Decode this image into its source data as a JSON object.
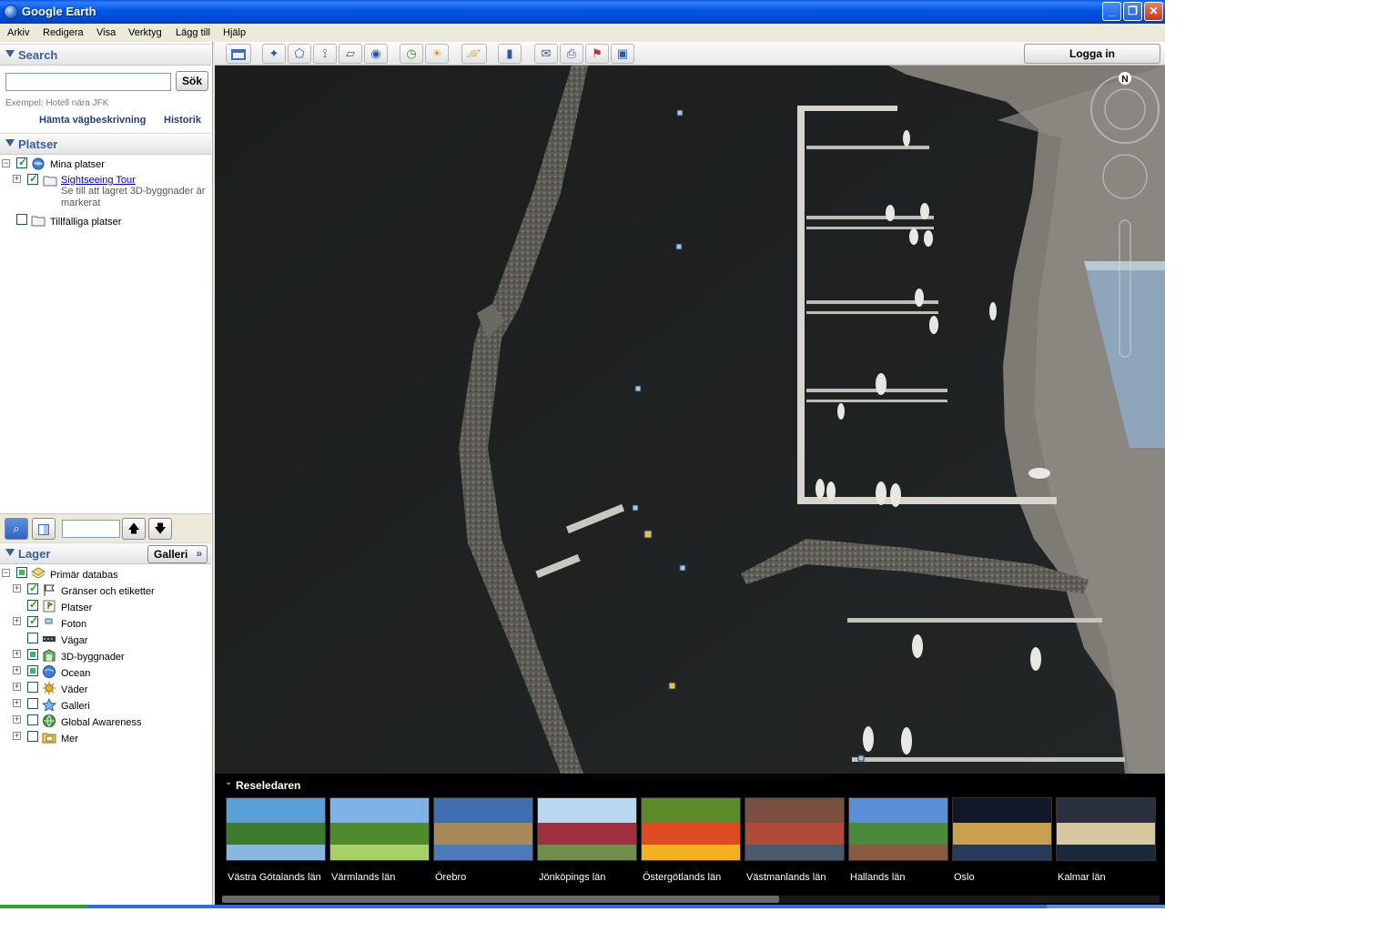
{
  "window": {
    "title": "Google Earth"
  },
  "menu": [
    "Arkiv",
    "Redigera",
    "Visa",
    "Verktyg",
    "Lägg till",
    "Hjälp"
  ],
  "search": {
    "title": "Search",
    "value": "",
    "placeholder": "",
    "button": "Sök",
    "example": "Exempel: Hotell nära JFK",
    "directions_link": "Hämta vägbeskrivning",
    "history_link": "Historik"
  },
  "places": {
    "title": "Platser",
    "my_places": "Mina platser",
    "tour_name": "Sightseeing Tour",
    "tour_desc_line1": "Se till att lagret 3D-byggnader är",
    "tour_desc_line2": "markerat",
    "temp_places": "Tillfälliga platser"
  },
  "layers": {
    "title": "Lager",
    "gallery_button": "Galleri",
    "primary_db": "Primär databas",
    "items": [
      {
        "label": "Gränser och etiketter",
        "checked": true,
        "expandable": true,
        "icon": "flag-icon"
      },
      {
        "label": "Platser",
        "checked": true,
        "expandable": false,
        "icon": "places-icon"
      },
      {
        "label": "Foton",
        "checked": true,
        "expandable": true,
        "icon": "photo-icon"
      },
      {
        "label": "Vägar",
        "checked": false,
        "expandable": false,
        "icon": "road-icon"
      },
      {
        "label": "3D-byggnader",
        "checked": "partial",
        "expandable": true,
        "icon": "building-icon"
      },
      {
        "label": "Ocean",
        "checked": "partial",
        "expandable": true,
        "icon": "ocean-icon"
      },
      {
        "label": "Väder",
        "checked": false,
        "expandable": true,
        "icon": "weather-icon"
      },
      {
        "label": "Galleri",
        "checked": false,
        "expandable": true,
        "icon": "gallery-star-icon"
      },
      {
        "label": "Global Awareness",
        "checked": false,
        "expandable": true,
        "icon": "globe-icon"
      },
      {
        "label": "Mer",
        "checked": false,
        "expandable": true,
        "icon": "folder-note-icon"
      }
    ]
  },
  "toolbar": {
    "login": "Logga in",
    "icons": [
      "sidebar-toggle-icon",
      "placemark-icon",
      "polygon-icon",
      "path-icon",
      "image-overlay-icon",
      "record-tour-icon",
      "historical-imagery-icon",
      "sunlight-icon",
      "planets-icon",
      "ruler-icon",
      "email-icon",
      "print-icon",
      "view-in-maps-icon",
      "save-image-icon"
    ]
  },
  "navigation": {
    "north_label": "N"
  },
  "tour_guide": {
    "title": "Reseledaren",
    "items": [
      "Västra Götalands län",
      "Värmlands län",
      "Örebro",
      "Jönköpings län",
      "Östergötlands län",
      "Västmanlands län",
      "Hallands län",
      "Oslo",
      "Kalmar län"
    ]
  }
}
